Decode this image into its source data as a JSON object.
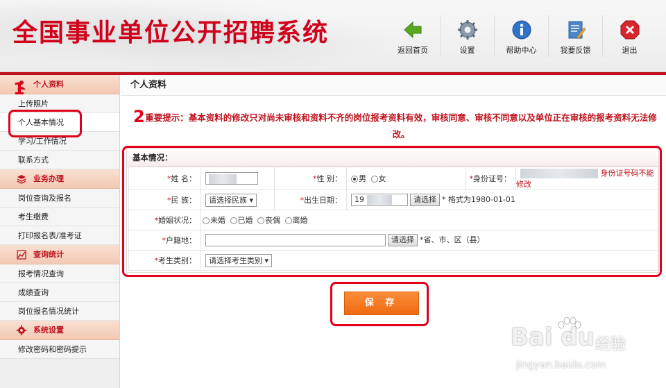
{
  "header": {
    "title": "全国事业单位公开招聘系统",
    "toolbar": [
      {
        "label": "返回首页",
        "icon": "back-arrow-icon"
      },
      {
        "label": "设置",
        "icon": "gear-icon"
      },
      {
        "label": "帮助中心",
        "icon": "info-icon"
      },
      {
        "label": "我要反馈",
        "icon": "feedback-icon"
      },
      {
        "label": "退出",
        "icon": "exit-icon"
      }
    ]
  },
  "sidebar": {
    "sections": [
      {
        "title": "个人资料",
        "items": [
          "上传照片",
          "个人基本情况",
          "学习/工作情况",
          "联系方式"
        ]
      },
      {
        "title": "业务办理",
        "items": [
          "岗位查询及报名",
          "考生缴费",
          "打印报名表/准考证"
        ]
      },
      {
        "title": "查询统计",
        "items": [
          "报考情况查询",
          "成绩查询",
          "岗位报名情况统计"
        ]
      },
      {
        "title": "系统设置",
        "items": [
          "修改密码和密码提示"
        ]
      }
    ]
  },
  "main": {
    "title": "个人资料",
    "notice": "重要提示：基本资料的修改只对尚未审核和资料不齐的岗位报考资料有效，审核同意、审核不同意以及单位正在审核的报考资料无法修改。",
    "form_title": "基本情况：",
    "fields": {
      "name_label": "姓    名：",
      "gender_label": "性    别：",
      "gender_male": "男",
      "gender_female": "女",
      "idcard_label": "身份证号：",
      "idcard_note": "身份证号码不能修改",
      "ethnic_label": "民    族：",
      "ethnic_select": "请选择民族",
      "birth_label": "出生日期：",
      "birth_value": "19",
      "choose_btn": "请选择",
      "birth_hint": "* 格式为1980-01-01",
      "marital_label": "婚姻状况：",
      "marital_options": [
        "未婚",
        "已婚",
        "丧偶",
        "离婚"
      ],
      "hukou_label": "户籍地：",
      "hukou_hint": "*省、市、区（县）",
      "category_label": "考生类别：",
      "category_select": "请选择考生类别"
    },
    "save_label": "保 存"
  },
  "annotations": [
    "1",
    "2"
  ],
  "watermark": {
    "logo": "Bai du",
    "cn": "经验",
    "url": "jingyan.baidu.com"
  },
  "colors": {
    "brand_red": "#c0121d",
    "save_orange": "#ef6a10",
    "annotation_red": "#e0001b"
  }
}
